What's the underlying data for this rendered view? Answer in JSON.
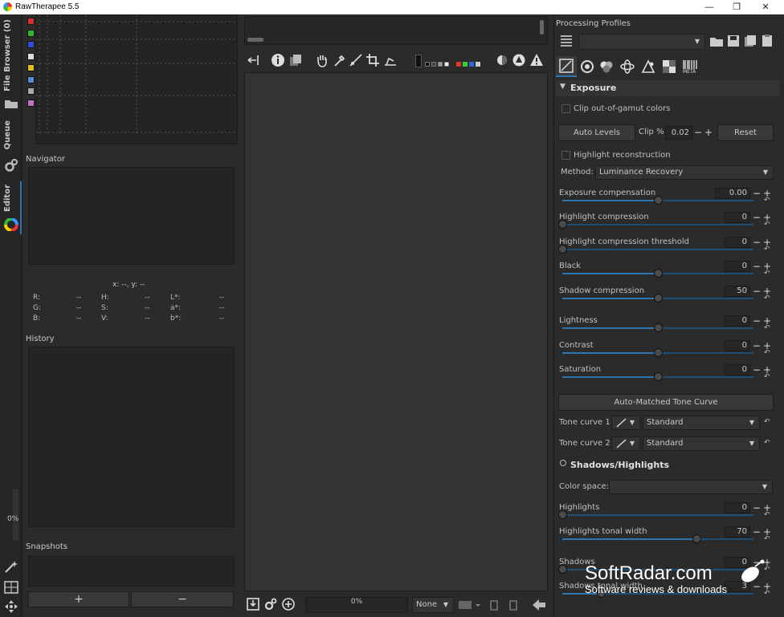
{
  "window": {
    "title": "RawTherapee 5.5",
    "controls": [
      "—",
      "❐",
      "✕"
    ]
  },
  "vtabs": {
    "file_browser": "File Browser (0)",
    "queue": "Queue",
    "editor": "Editor"
  },
  "left": {
    "navigator_title": "Navigator",
    "coords": "x: --, y: --",
    "readouts": {
      "r": "R:",
      "r_val": "--",
      "g": "G:",
      "g_val": "--",
      "b": "B:",
      "b_val": "--",
      "h": "H:",
      "h_val": "--",
      "s": "S:",
      "s_val": "--",
      "v": "V:",
      "v_val": "--",
      "l": "L*:",
      "l_val": "--",
      "a": "a*:",
      "a_val": "--",
      "bb": "b*:",
      "bb_val": "--"
    },
    "history_title": "History",
    "snapshots_title": "Snapshots",
    "snap_add": "+",
    "snap_remove": "−",
    "progress": "0%"
  },
  "histogram_swatches": [
    "#d62f2f",
    "#2fb52f",
    "#2f4fd6",
    "#dddddd",
    "#e0c020",
    "#5a8ad0",
    "#aaaaaa",
    "#c070c0"
  ],
  "bottom_bar": {
    "progress": "0%",
    "zoom_select": "None"
  },
  "right": {
    "profiles_title": "Processing Profiles",
    "profile_value": "",
    "exposure": {
      "title": "Exposure",
      "clip_gamut": "Clip out-of-gamut colors",
      "auto_levels": "Auto Levels",
      "clip_label": "Clip %",
      "clip_value": "0.02",
      "reset": "Reset",
      "highlight_recon": "Highlight reconstruction",
      "method_label": "Method:",
      "method_value": "Luminance Recovery",
      "sliders": [
        {
          "label": "Exposure compensation",
          "value": "0.00",
          "pos": 0.5
        },
        {
          "label": "Highlight compression",
          "value": "0",
          "pos": 0.0
        },
        {
          "label": "Highlight compression threshold",
          "value": "0",
          "pos": 0.0
        },
        {
          "label": "Black",
          "value": "0",
          "pos": 0.5
        },
        {
          "label": "Shadow compression",
          "value": "50",
          "pos": 0.5
        },
        {
          "label": "Lightness",
          "value": "0",
          "pos": 0.5
        },
        {
          "label": "Contrast",
          "value": "0",
          "pos": 0.5
        },
        {
          "label": "Saturation",
          "value": "0",
          "pos": 0.5
        }
      ],
      "auto_tone_curve": "Auto-Matched Tone Curve",
      "tone_curve_1_label": "Tone curve 1:",
      "tone_curve_1_value": "Standard",
      "tone_curve_2_label": "Tone curve 2:",
      "tone_curve_2_value": "Standard"
    },
    "shadows_highlights": {
      "title": "Shadows/Highlights",
      "color_space_label": "Color space:",
      "color_space_value": "",
      "sliders": [
        {
          "label": "Highlights",
          "value": "0",
          "pos": 0.0
        },
        {
          "label": "Highlights tonal width",
          "value": "70",
          "pos": 0.7
        },
        {
          "label": "Shadows",
          "value": "0",
          "pos": 0.0
        },
        {
          "label": "Shadows tonal width",
          "value": "3",
          "pos": 0.2
        }
      ]
    }
  },
  "watermark": {
    "brand": "SoftRadar.com",
    "tagline": "Software reviews & downloads"
  }
}
